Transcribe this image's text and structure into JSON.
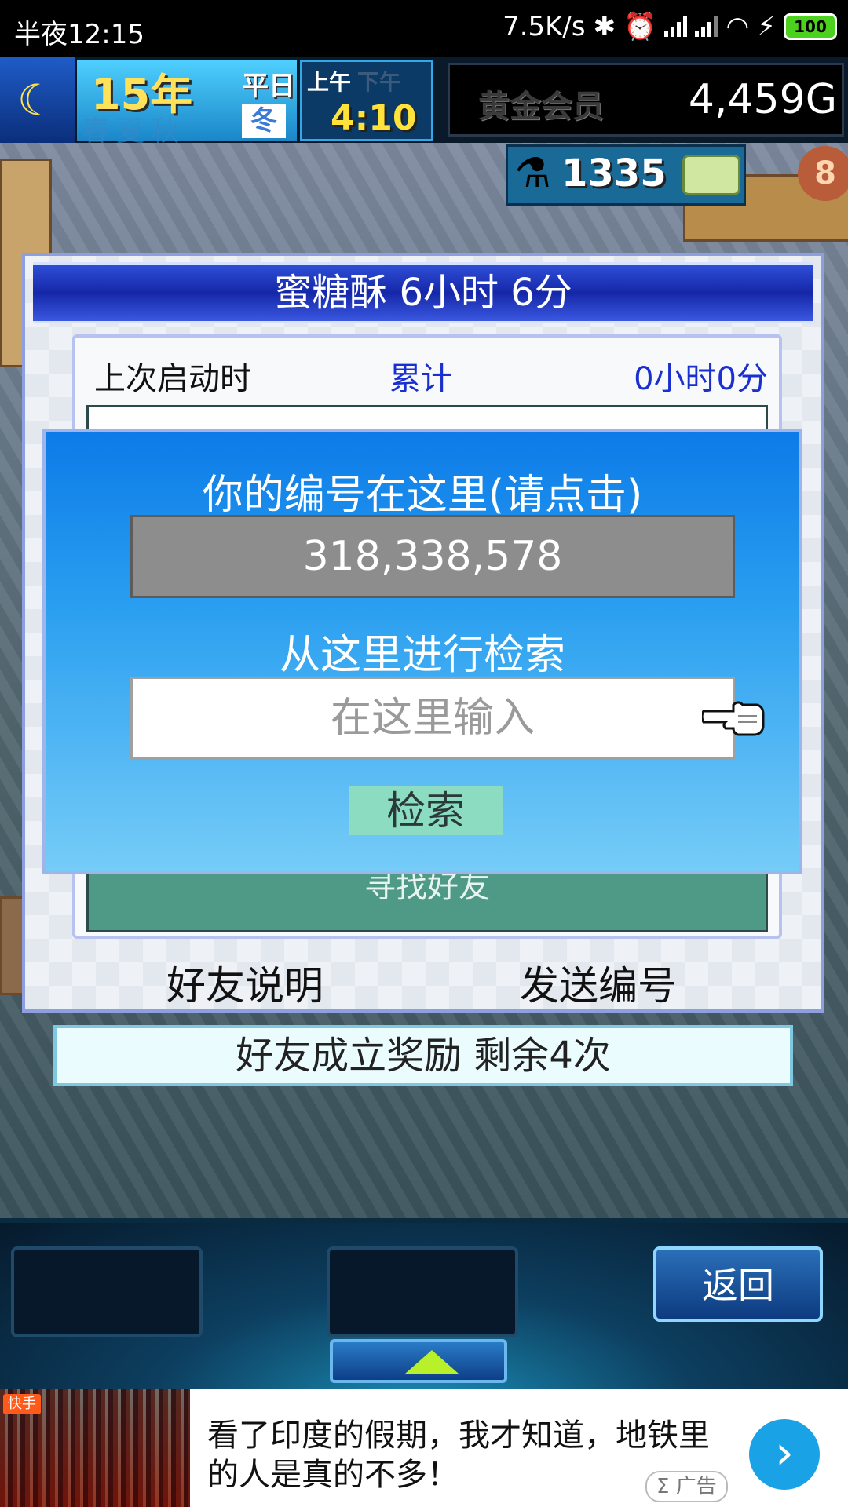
{
  "status_bar": {
    "time": "半夜12:15",
    "speed": "7.5K/s",
    "battery": "100",
    "icons": [
      "bluetooth-icon",
      "alarm-icon",
      "signal-icon",
      "signal-icon",
      "wifi-icon",
      "charging-icon",
      "battery-icon"
    ]
  },
  "hud": {
    "year": "15年",
    "day_type": "平日",
    "season": "冬",
    "season_row_faded": "春夏秋",
    "am": "上午",
    "pm": "下午",
    "clock": "4:10",
    "member": "黄金会员",
    "gold": "4,459G",
    "research_points": "1335",
    "badge_number": "8"
  },
  "dialog": {
    "title": "蜜糖酥  6小时 6分",
    "info_label": "上次启动时",
    "info_mid": "累计",
    "info_right": "0小时0分",
    "find_friend": "寻找好友",
    "friend_help": "好友说明",
    "send_id": "发送编号"
  },
  "reward": "好友成立奖励  剩余4次",
  "popup": {
    "title": "你的编号在这里(请点击)",
    "id_value": "318,338,578",
    "search_title": "从这里进行检索",
    "search_placeholder": "在这里输入",
    "search_button": "检索"
  },
  "bottom_panel": {
    "back_button": "返回"
  },
  "ad": {
    "source": "快手",
    "text": "看了印度的假期，我才知道，地铁里的人是真的不多！",
    "badge": "Σ 广告"
  },
  "colors": {
    "popup_top": "#0c7be8",
    "popup_bottom": "#76ccf7",
    "dialog_title": "#1527a8",
    "accent_blue_text": "#1a2fd0",
    "search_button": "#8bdcc0",
    "ad_arrow": "#1aa2e6"
  }
}
